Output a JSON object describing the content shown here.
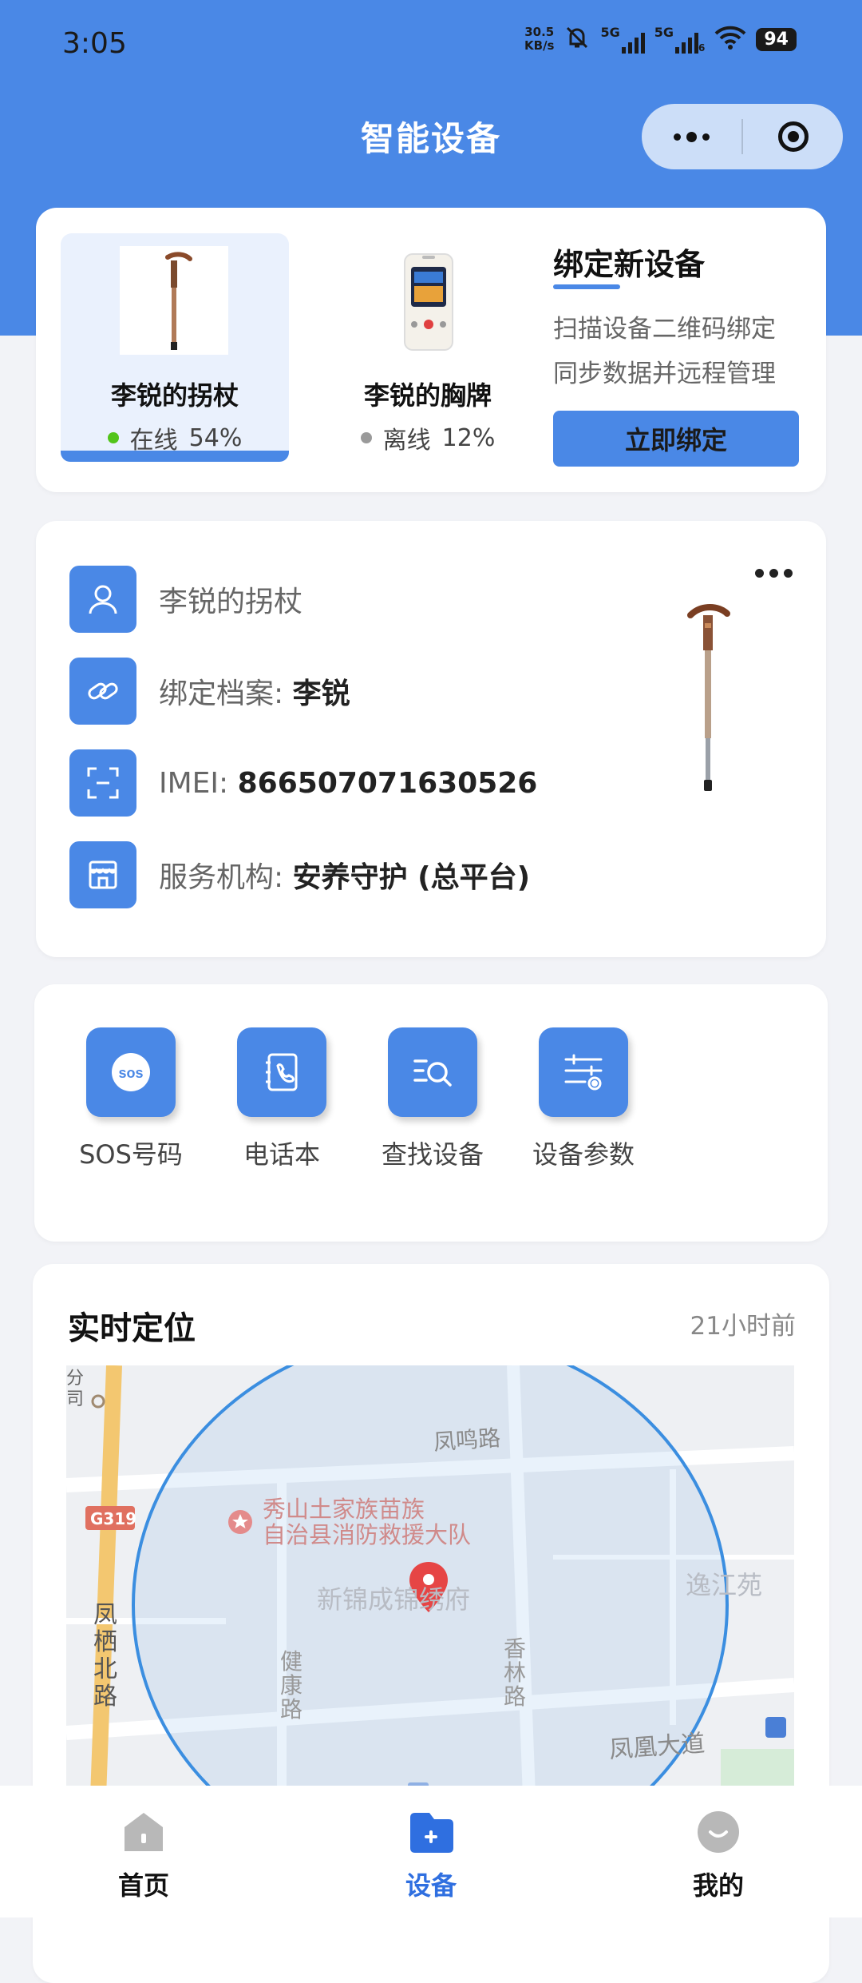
{
  "status_bar": {
    "time": "3:05",
    "net_speed_value": "30.5",
    "net_speed_unit": "KB/s",
    "signal1_label": "5G",
    "signal2_label": "5G",
    "signal2_sub": "6",
    "battery": "94"
  },
  "header": {
    "title": "智能设备"
  },
  "devices": [
    {
      "name": "李锐的拐杖",
      "status": "在线",
      "battery": "54%",
      "status_color": "#52c41a",
      "active": true
    },
    {
      "name": "李锐的胸牌",
      "status": "离线",
      "battery": "12%",
      "status_color": "#9a9a9a",
      "active": false
    }
  ],
  "bind_new": {
    "title": "绑定新设备",
    "desc_line1": "扫描设备二维码绑定",
    "desc_line2": "同步数据并远程管理",
    "button": "立即绑定"
  },
  "device_info": {
    "name": "李锐的拐杖",
    "profile_label": "绑定档案:",
    "profile_value": "李锐",
    "imei_label": "IMEI:",
    "imei_value": "866507071630526",
    "org_label": "服务机构:",
    "org_value": "安养守护 (总平台)"
  },
  "functions": [
    {
      "label": "SOS号码",
      "icon": "sos-icon"
    },
    {
      "label": "电话本",
      "icon": "phonebook-icon"
    },
    {
      "label": "查找设备",
      "icon": "find-device-icon"
    },
    {
      "label": "设备参数",
      "icon": "device-settings-icon"
    }
  ],
  "location": {
    "title": "实时定位",
    "updated": "21小时前",
    "map_labels": {
      "road_fengming": "凤鸣路",
      "poi_fire": "秀山土家族苗族",
      "poi_fire2": "自治县消防救援大队",
      "poi_xinjin": "新锦成锦绣府",
      "poi_yijiang": "逸江苑",
      "road_g319": "G319",
      "road_fengqi": "凤栖北路",
      "road_jiankang": "健康路",
      "road_xianglin": "香林路",
      "road_fenghuang": "凤凰大道",
      "edge_text1": "分",
      "edge_text2": "司"
    }
  },
  "bottom_nav": [
    {
      "label": "首页",
      "active": false
    },
    {
      "label": "设备",
      "active": true
    },
    {
      "label": "我的",
      "active": false
    }
  ],
  "colors": {
    "primary": "#4a88e6",
    "online": "#52c41a",
    "offline": "#9a9a9a"
  }
}
